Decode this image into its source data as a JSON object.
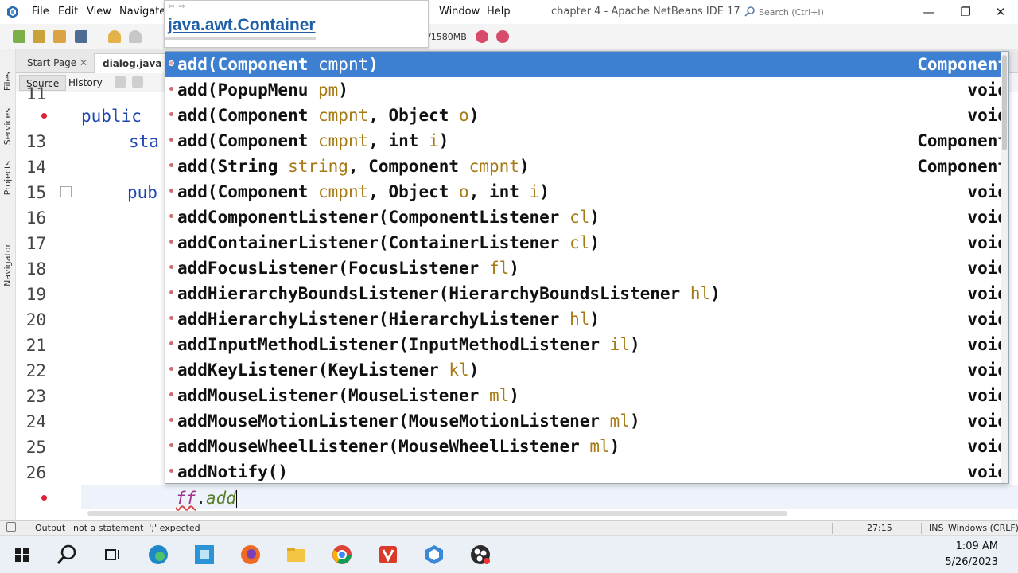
{
  "window": {
    "title": "chapter 4 - Apache NetBeans IDE 17",
    "menus": [
      "File",
      "Edit",
      "View",
      "Navigate",
      "Window",
      "Help"
    ],
    "search_placeholder": "Search (Ctrl+I)",
    "minimize": "—",
    "maximize": "❐",
    "close": "✕"
  },
  "toolbar": {
    "memory": "/1580MB"
  },
  "tooltip": {
    "nav": "⇦ ⇨",
    "title": "java.awt.Container"
  },
  "side_panels": [
    "Files",
    "Services",
    "Projects",
    "Navigator"
  ],
  "tabs": {
    "start_page": "Start Page",
    "start_close": "✕",
    "dialog": "dialog.java"
  },
  "views": {
    "source": "Source",
    "history": "History"
  },
  "editor": {
    "line_numbers": [
      "11",
      "",
      "13",
      "14",
      "15",
      "16",
      "17",
      "18",
      "19",
      "20",
      "21",
      "22",
      "23",
      "24",
      "25",
      "26",
      ""
    ],
    "code": {
      "public_kw": "public",
      "static_fragment": "sta",
      "public_fragment": "pub",
      "typed_var": "ff",
      "dot": ".",
      "typed_method": "add"
    }
  },
  "completion": {
    "items": [
      {
        "sig": "add(",
        "params": [
          [
            "Component ",
            "cmpnt"
          ]
        ],
        "tail": ")",
        "type": "Component",
        "selected": true
      },
      {
        "sig": "add(",
        "params": [
          [
            "PopupMenu ",
            "pm"
          ]
        ],
        "tail": ")",
        "type": "void"
      },
      {
        "sig": "add(",
        "params": [
          [
            "Component ",
            "cmpnt"
          ],
          [
            ", Object ",
            "o"
          ]
        ],
        "tail": ")",
        "type": "void"
      },
      {
        "sig": "add(",
        "params": [
          [
            "Component ",
            "cmpnt"
          ],
          [
            ", int ",
            "i"
          ]
        ],
        "tail": ")",
        "type": "Component"
      },
      {
        "sig": "add(",
        "params": [
          [
            "String ",
            "string"
          ],
          [
            ", Component ",
            "cmpnt"
          ]
        ],
        "tail": ")",
        "type": "Component"
      },
      {
        "sig": "add(",
        "params": [
          [
            "Component ",
            "cmpnt"
          ],
          [
            ", Object ",
            "o"
          ],
          [
            ", int ",
            "i"
          ]
        ],
        "tail": ")",
        "type": "void"
      },
      {
        "sig": "addComponentListener(",
        "params": [
          [
            "ComponentListener ",
            "cl"
          ]
        ],
        "tail": ")",
        "type": "void"
      },
      {
        "sig": "addContainerListener(",
        "params": [
          [
            "ContainerListener ",
            "cl"
          ]
        ],
        "tail": ")",
        "type": "void"
      },
      {
        "sig": "addFocusListener(",
        "params": [
          [
            "FocusListener ",
            "fl"
          ]
        ],
        "tail": ")",
        "type": "void"
      },
      {
        "sig": "addHierarchyBoundsListener(",
        "params": [
          [
            "HierarchyBoundsListener ",
            "hl"
          ]
        ],
        "tail": ")",
        "type": "void"
      },
      {
        "sig": "addHierarchyListener(",
        "params": [
          [
            "HierarchyListener ",
            "hl"
          ]
        ],
        "tail": ")",
        "type": "void"
      },
      {
        "sig": "addInputMethodListener(",
        "params": [
          [
            "InputMethodListener ",
            "il"
          ]
        ],
        "tail": ")",
        "type": "void"
      },
      {
        "sig": "addKeyListener(",
        "params": [
          [
            "KeyListener ",
            "kl"
          ]
        ],
        "tail": ")",
        "type": "void"
      },
      {
        "sig": "addMouseListener(",
        "params": [
          [
            "MouseListener ",
            "ml"
          ]
        ],
        "tail": ")",
        "type": "void"
      },
      {
        "sig": "addMouseMotionListener(",
        "params": [
          [
            "MouseMotionListener ",
            "ml"
          ]
        ],
        "tail": ")",
        "type": "void"
      },
      {
        "sig": "addMouseWheelListener(",
        "params": [
          [
            "MouseWheelListener ",
            "ml"
          ]
        ],
        "tail": ")",
        "type": "void"
      },
      {
        "sig": "addNotify()",
        "params": [],
        "tail": "",
        "type": "void"
      }
    ]
  },
  "statusbar": {
    "output": "Output",
    "message": "not a statement  ';' expected",
    "position": "27:15",
    "mode": "INS",
    "line_endings": "Windows (CRLF)"
  },
  "taskbar": {
    "time": "1:09 AM",
    "date": "5/26/2023"
  },
  "colors": {
    "selection": "#3d7fd1",
    "keyword": "#1f47b3",
    "param": "#a67a14",
    "link": "#1f5fa8"
  }
}
